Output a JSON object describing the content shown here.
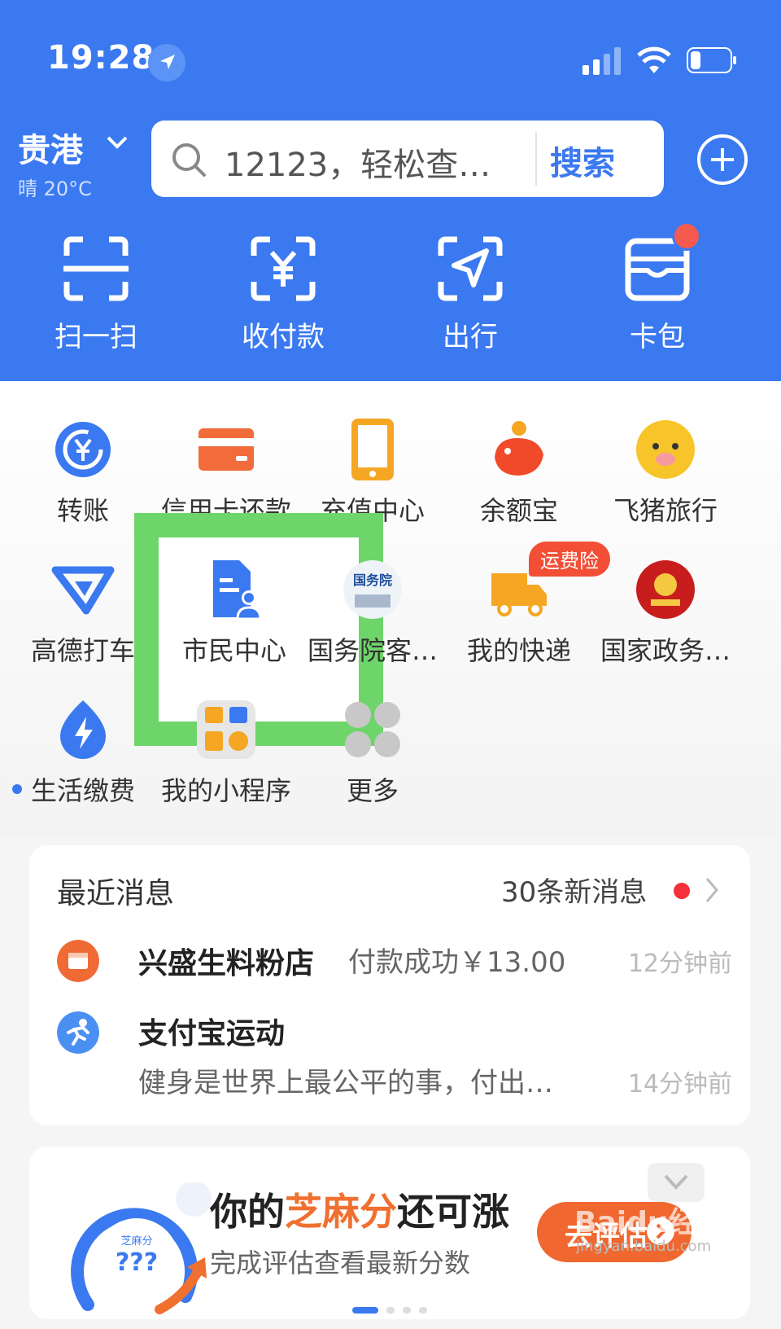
{
  "status": {
    "time": "19:28"
  },
  "header": {
    "city": "贵港",
    "weather": "晴 20°C",
    "search_placeholder": "12123，轻松查…",
    "search_button": "搜索"
  },
  "quick_actions": [
    {
      "label": "扫一扫",
      "icon": "scan-icon"
    },
    {
      "label": "收付款",
      "icon": "payment-code-icon"
    },
    {
      "label": "出行",
      "icon": "travel-icon"
    },
    {
      "label": "卡包",
      "icon": "card-wallet-icon"
    }
  ],
  "services": [
    {
      "label": "转账",
      "icon": "transfer-icon"
    },
    {
      "label": "信用卡还款",
      "icon": "credit-card-icon"
    },
    {
      "label": "充值中心",
      "icon": "phone-recharge-icon"
    },
    {
      "label": "余额宝",
      "icon": "yuebao-icon"
    },
    {
      "label": "飞猪旅行",
      "icon": "fliggy-icon"
    },
    {
      "label": "高德打车",
      "icon": "amap-taxi-icon"
    },
    {
      "label": "市民中心",
      "icon": "citizen-center-icon"
    },
    {
      "label": "国务院客…",
      "icon": "state-council-icon"
    },
    {
      "label": "我的快递",
      "icon": "express-truck-icon"
    },
    {
      "label": "国家政务…",
      "icon": "national-emblem-icon"
    },
    {
      "label": "生活缴费",
      "icon": "utility-bolt-icon"
    },
    {
      "label": "我的小程序",
      "icon": "mini-programs-icon"
    },
    {
      "label": "更多",
      "icon": "more-grid-icon"
    }
  ],
  "state_council_logo_text": "国务院",
  "badges": {
    "express": "运费险"
  },
  "messages": {
    "title": "最近消息",
    "count": "30条新消息",
    "items": [
      {
        "name": "兴盛生料粉店",
        "text": "付款成功￥13.00",
        "time": "12分钟前"
      },
      {
        "name": "支付宝运动",
        "text": "健身是世界上最公平的事，付出…",
        "time": "14分钟前"
      }
    ]
  },
  "zhima": {
    "title_pre": "你的",
    "title_accent": "芝麻分",
    "title_post": "还可涨",
    "subtitle": "完成评估查看最新分数",
    "button": "去评估",
    "gauge_label": "芝麻分",
    "gauge_value": "???"
  },
  "watermark": {
    "main": "Baidu经验",
    "sub": "jingyan.baidu.com"
  },
  "colors": {
    "brand_blue": "#3b79f0",
    "highlight_green": "#6ed56a",
    "accent_orange": "#f07030"
  }
}
